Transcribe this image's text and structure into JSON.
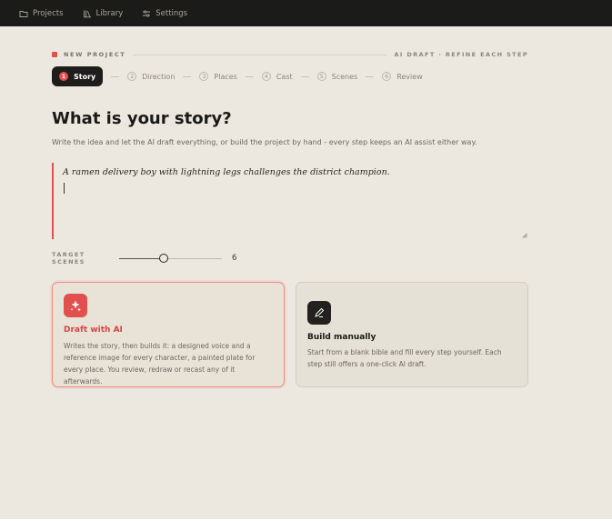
{
  "topbar": {
    "items": [
      {
        "label": "Projects",
        "icon": "folder-icon"
      },
      {
        "label": "Library",
        "icon": "books-icon"
      },
      {
        "label": "Settings",
        "icon": "sliders-icon"
      }
    ]
  },
  "header": {
    "eyebrow": "NEW PROJECT",
    "eyebrow_right": "AI DRAFT · REFINE EACH STEP"
  },
  "steps": [
    {
      "num": "1",
      "label": "Story",
      "active": true
    },
    {
      "num": "2",
      "label": "Direction"
    },
    {
      "num": "3",
      "label": "Places"
    },
    {
      "num": "4",
      "label": "Cast"
    },
    {
      "num": "5",
      "label": "Scenes"
    },
    {
      "num": "6",
      "label": "Review"
    }
  ],
  "main": {
    "title": "What is your story?",
    "subtitle": "Write the idea and let the AI draft everything, or build the project by hand - every step keeps an AI assist either way.",
    "story_value": "A ramen delivery boy with lightning legs challenges the district champion."
  },
  "scenes": {
    "label": "TARGET SCENES",
    "value": "6",
    "fraction": 0.43
  },
  "cards": {
    "ai": {
      "icon": "sparkles-icon",
      "title": "Draft with AI",
      "desc": "Writes the story, then builds it: a designed voice and a reference image for every character, a painted plate for every place. You review, redraw or recast any of it afterwards."
    },
    "manual": {
      "icon": "pen-icon",
      "title": "Build manually",
      "desc": "Start from a blank bible and fill every step yourself. Each step still offers a one-click AI draft."
    }
  },
  "colors": {
    "accent": "#e0504e",
    "topbar": "#1b1b1a",
    "background": "#ece8df"
  }
}
